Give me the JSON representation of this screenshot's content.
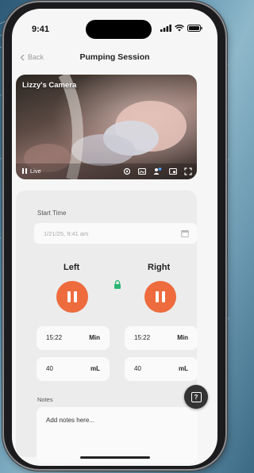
{
  "status_bar": {
    "time": "9:41"
  },
  "nav": {
    "back_label": "Back",
    "title": "Pumping Session"
  },
  "camera": {
    "name": "Lizzy's Camera",
    "live_label": "Live"
  },
  "session": {
    "start_time_label": "Start Time",
    "start_time_value": "1/21/25, 9:41 am",
    "left": {
      "label": "Left",
      "time": "15:22",
      "time_unit": "Min",
      "volume": "40",
      "volume_unit": "mL"
    },
    "right": {
      "label": "Right",
      "time": "15:22",
      "time_unit": "Min",
      "volume": "40",
      "volume_unit": "mL"
    },
    "notes_label": "Notes",
    "notes_placeholder": "Add notes here..."
  },
  "colors": {
    "accent": "#ee6b3d",
    "lock": "#2bb673",
    "help_button": "#333333"
  }
}
